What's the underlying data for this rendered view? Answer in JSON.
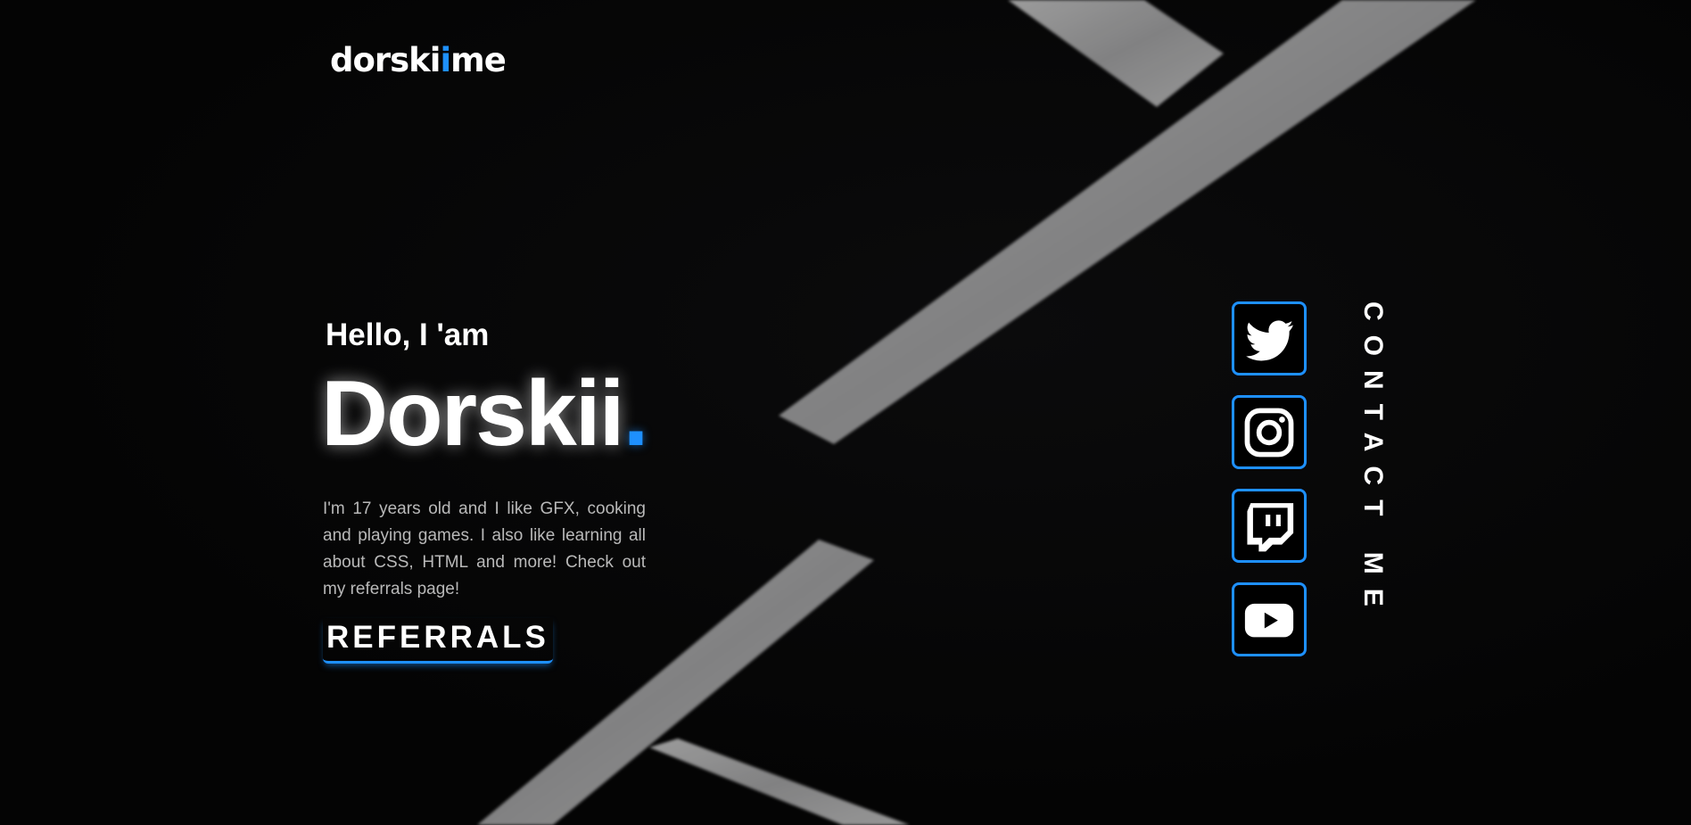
{
  "logo": {
    "text_start": "dorski",
    "dot_char": "i",
    "text_end": "me",
    "accent": "#1e90ff"
  },
  "hero": {
    "greeting": "Hello, I 'am",
    "name": "Dorskii",
    "name_accent": ".",
    "bio": "I'm 17 years old and I like GFX, cooking and playing games. I also like learning all about CSS, HTML and more! Check out my referrals page!",
    "cta_label": "REFERRALS"
  },
  "socials": [
    {
      "name": "twitter",
      "icon": "twitter-icon"
    },
    {
      "name": "instagram",
      "icon": "instagram-icon"
    },
    {
      "name": "twitch",
      "icon": "twitch-icon"
    },
    {
      "name": "youtube",
      "icon": "youtube-icon"
    }
  ],
  "contact": {
    "label": "CONTACT ME"
  },
  "colors": {
    "background": "#050505",
    "accent": "#1e90ff",
    "text": "#ffffff",
    "muted_text": "#b9b9b9"
  }
}
